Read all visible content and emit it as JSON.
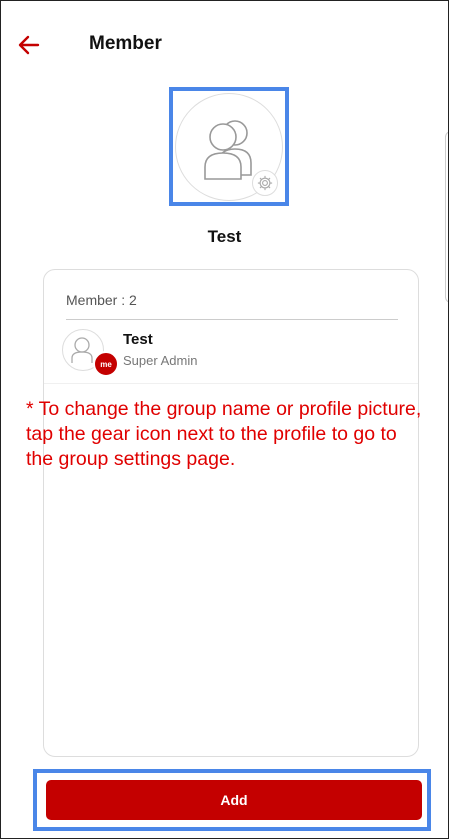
{
  "header": {
    "title": "Member"
  },
  "group": {
    "name": "Test"
  },
  "members": {
    "count_label": "Member : 2",
    "items": [
      {
        "name": "Test",
        "role": "Super Admin",
        "badge": "me"
      }
    ]
  },
  "annotation": {
    "note": "* To change the group name or profile picture, tap the gear icon next to the profile to go to the group settings page."
  },
  "actions": {
    "add_label": "Add"
  },
  "colors": {
    "accent": "#c40000",
    "highlight": "#4a86e8",
    "note": "#e00000"
  }
}
